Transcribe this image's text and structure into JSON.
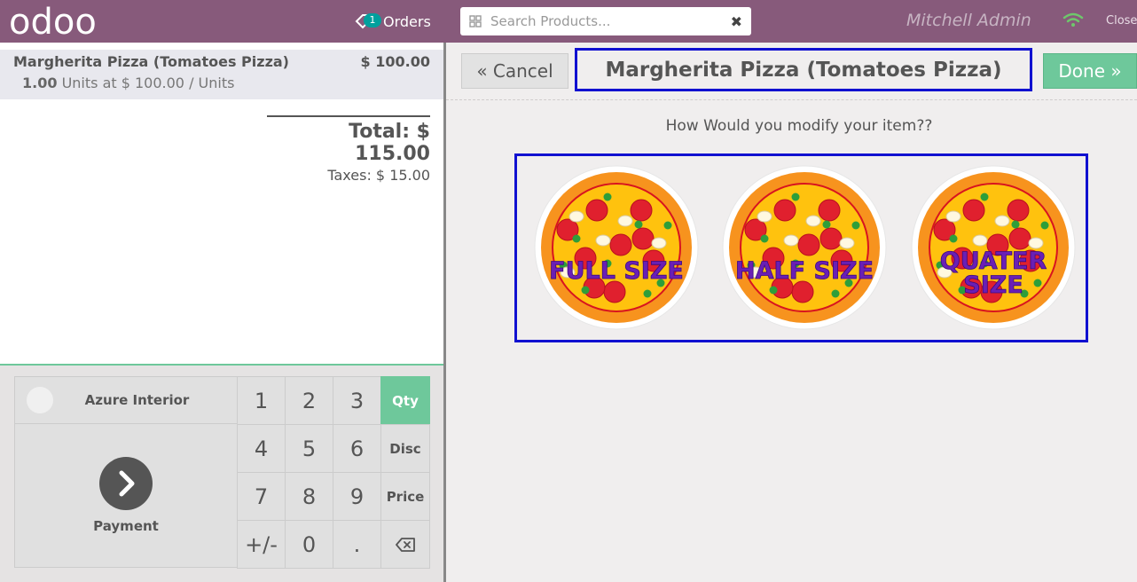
{
  "header": {
    "logo": "odoo",
    "orders_count": "1",
    "orders_label": "Orders",
    "search_placeholder": "Search Products...",
    "user_name": "Mitchell Admin",
    "close_label": "Close"
  },
  "order": {
    "lines": [
      {
        "name": "Margherita Pizza (Tomatoes Pizza)",
        "price": "$ 100.00",
        "qty": "1.00",
        "unit_info": "Units at $ 100.00 / Units"
      }
    ],
    "total": "Total: $ 115.00",
    "taxes": "Taxes: $ 15.00"
  },
  "pad": {
    "customer": "Azure Interior",
    "payment": "Payment",
    "keys": [
      "1",
      "2",
      "3",
      "Qty",
      "4",
      "5",
      "6",
      "Disc",
      "7",
      "8",
      "9",
      "Price",
      "+/-",
      "0",
      "."
    ],
    "active_mode": "Qty"
  },
  "popup": {
    "cancel_label": "« Cancel",
    "title": "Margherita Pizza (Tomatoes Pizza)",
    "done_label": "Done »",
    "question": "How Would you modify your item??",
    "options": [
      {
        "label_lines": [
          "FULL SIZE"
        ]
      },
      {
        "label_lines": [
          "HALF SIZE"
        ]
      },
      {
        "label_lines": [
          "QUATER",
          "SIZE"
        ]
      }
    ]
  },
  "colors": {
    "header": "#875a7b",
    "accent_green": "#6ec89b",
    "highlight_blue": "#1010d0",
    "badge": "#00a09d",
    "pizza_label": "#6a1fb5"
  }
}
